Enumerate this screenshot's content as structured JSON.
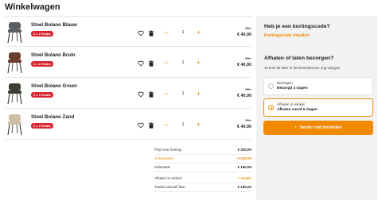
{
  "page": {
    "title": "Winkelwagen"
  },
  "cart": {
    "items": [
      {
        "name": "Stoel Bolano Blauw",
        "badge": "2 = 2 Gratis",
        "quantity": "1",
        "old_price": "80,-",
        "new_price": "€ 40,00",
        "color": "#5b5e60"
      },
      {
        "name": "Stoel Bolano Bruin",
        "badge": "2 = 2 Gratis",
        "quantity": "1",
        "old_price": "80,-",
        "new_price": "€ 40,00",
        "color": "#6a3e2c"
      },
      {
        "name": "Stoel Bolano Groen",
        "badge": "2 = 2 Gratis",
        "quantity": "1",
        "old_price": "80,-",
        "new_price": "€ 40,00",
        "color": "#3f3d36"
      },
      {
        "name": "Stoel Bolano Zand",
        "badge": "2 = 2 Gratis",
        "quantity": "1",
        "old_price": "80,-",
        "new_price": "€ 40,00",
        "color": "#cdbda5"
      }
    ],
    "icons": {
      "favorite": "heart-icon",
      "delete": "trash-icon",
      "decrease": "minus-icon",
      "increase": "plus-icon"
    }
  },
  "totals": {
    "price_before_discount_label": "Prijs voor korting:",
    "price_before_discount_value": "€ 320,00",
    "saved_label": "Je bespaart:",
    "saved_value": "- € 160,00",
    "subtotal_label": "Subtotaal:",
    "subtotal_value": "€ 160,00",
    "pickup_label": "Afhalen in winkel:",
    "pickup_value": "✓ Gratis",
    "total_label": "Totaal inclusief btw:",
    "total_value": "€ 160,00"
  },
  "sidebar": {
    "discount_title": "Heb je een kortingscode?",
    "discount_link": "Kortingscode invullen",
    "delivery_title": "Afhalen of laten bezorgen?",
    "delivery_helper": "Je kunt dit later in het bestelproces nog wijzigen",
    "options": [
      {
        "title": "Bezorgen",
        "subtitle": "Bezorgd 4 dagen",
        "selected": false
      },
      {
        "title": "Afhalen in winkel",
        "subtitle": "Afhalen vanaf 5 dagen",
        "selected": true
      }
    ],
    "cta_label": "Verder met bestellen",
    "cta_icon": "chevron-right-icon"
  },
  "colors": {
    "accent": "#f18a00",
    "badge": "#d7262f",
    "panel": "#f2f2f2"
  }
}
